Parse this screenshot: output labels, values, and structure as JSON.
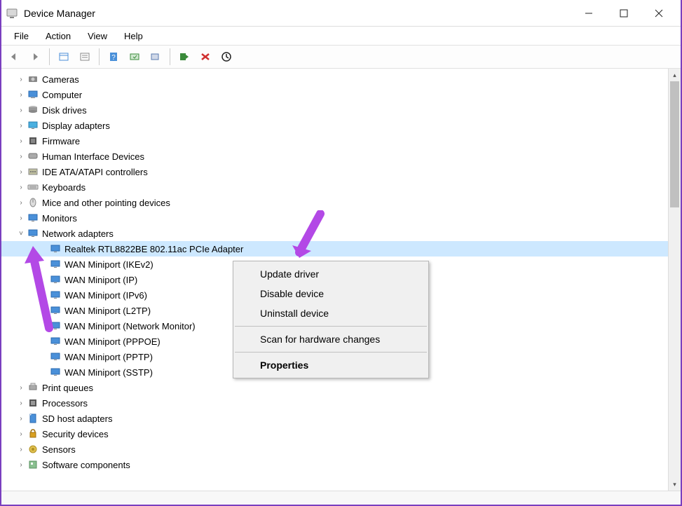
{
  "window": {
    "title": "Device Manager"
  },
  "menubar": [
    "File",
    "Action",
    "View",
    "Help"
  ],
  "tree": {
    "categories": [
      {
        "label": "Cameras",
        "icon": "camera",
        "expanded": false
      },
      {
        "label": "Computer",
        "icon": "computer",
        "expanded": false
      },
      {
        "label": "Disk drives",
        "icon": "disk",
        "expanded": false
      },
      {
        "label": "Display adapters",
        "icon": "display",
        "expanded": false
      },
      {
        "label": "Firmware",
        "icon": "firmware",
        "expanded": false
      },
      {
        "label": "Human Interface Devices",
        "icon": "hid",
        "expanded": false
      },
      {
        "label": "IDE ATA/ATAPI controllers",
        "icon": "ide",
        "expanded": false
      },
      {
        "label": "Keyboards",
        "icon": "keyboard",
        "expanded": false
      },
      {
        "label": "Mice and other pointing devices",
        "icon": "mouse",
        "expanded": false
      },
      {
        "label": "Monitors",
        "icon": "monitor",
        "expanded": false
      },
      {
        "label": "Network adapters",
        "icon": "network",
        "expanded": true,
        "children": [
          {
            "label": "Realtek RTL8822BE 802.11ac PCIe Adapter",
            "selected": true
          },
          {
            "label": "WAN Miniport (IKEv2)"
          },
          {
            "label": "WAN Miniport (IP)"
          },
          {
            "label": "WAN Miniport (IPv6)"
          },
          {
            "label": "WAN Miniport (L2TP)"
          },
          {
            "label": "WAN Miniport (Network Monitor)"
          },
          {
            "label": "WAN Miniport (PPPOE)"
          },
          {
            "label": "WAN Miniport (PPTP)"
          },
          {
            "label": "WAN Miniport (SSTP)"
          }
        ]
      },
      {
        "label": "Print queues",
        "icon": "printer",
        "expanded": false
      },
      {
        "label": "Processors",
        "icon": "cpu",
        "expanded": false
      },
      {
        "label": "SD host adapters",
        "icon": "sd",
        "expanded": false
      },
      {
        "label": "Security devices",
        "icon": "security",
        "expanded": false
      },
      {
        "label": "Sensors",
        "icon": "sensor",
        "expanded": false
      },
      {
        "label": "Software components",
        "icon": "software",
        "expanded": false
      }
    ]
  },
  "context_menu": {
    "update": "Update driver",
    "disable": "Disable device",
    "uninstall": "Uninstall device",
    "scan": "Scan for hardware changes",
    "properties": "Properties"
  }
}
